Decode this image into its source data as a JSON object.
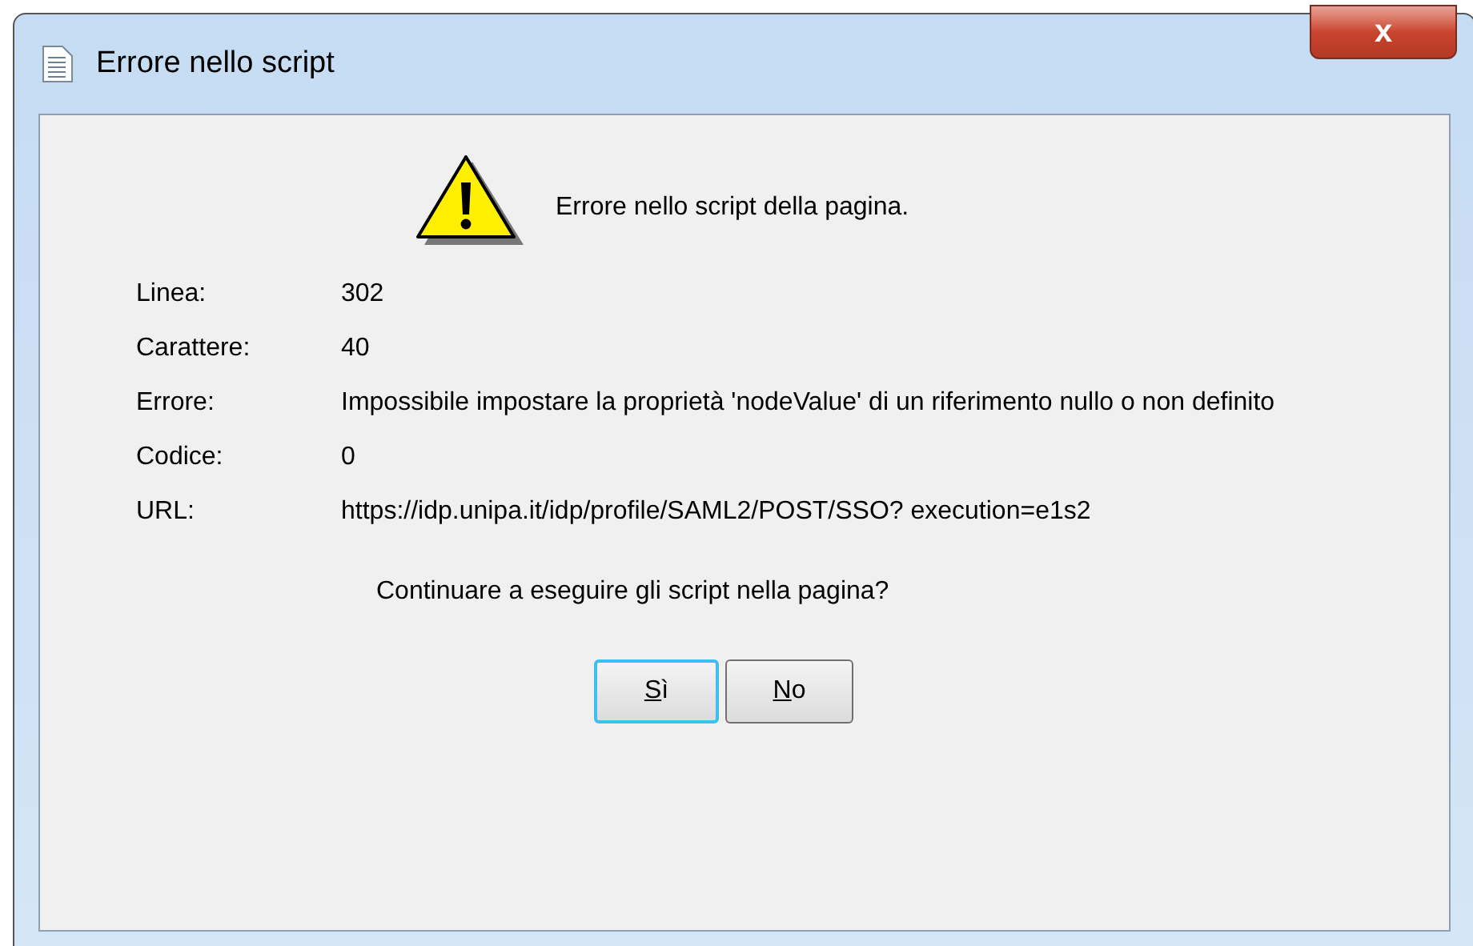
{
  "window": {
    "title": "Errore nello script",
    "close": "x"
  },
  "message": "Errore nello script della pagina.",
  "details": [
    {
      "label": "Linea:",
      "value": "302"
    },
    {
      "label": "Carattere:",
      "value": "40"
    },
    {
      "label": "Errore:",
      "value": "Impossibile impostare la proprietà 'nodeValue' di un riferimento nullo o non definito"
    },
    {
      "label": "Codice:",
      "value": "0"
    },
    {
      "label": "URL:",
      "value": "https://idp.unipa.it/idp/profile/SAML2/POST/SSO? execution=e1s2"
    }
  ],
  "question": "Continuare a eseguire gli script nella pagina?",
  "buttons": [
    {
      "label": "Sì",
      "default": true
    },
    {
      "label": "No",
      "default": false
    }
  ]
}
